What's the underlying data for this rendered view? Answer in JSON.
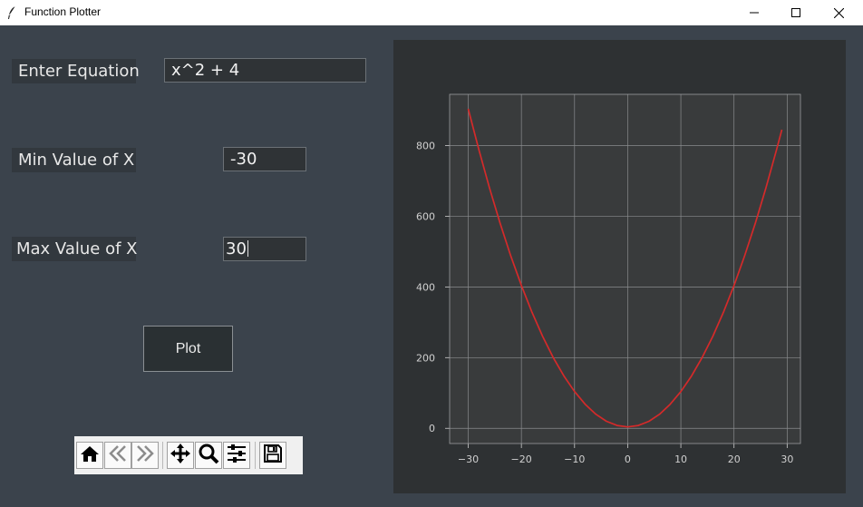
{
  "window": {
    "title": "Function Plotter",
    "app_icon": "feather-icon",
    "controls": [
      "minimize-icon",
      "maximize-icon",
      "close-icon"
    ]
  },
  "form": {
    "equation": {
      "label": "Enter Equation",
      "value": "x^2 + 4"
    },
    "min_x": {
      "label": "Min Value of X",
      "value": "-30"
    },
    "max_x": {
      "label": "Max Value of X",
      "value": "30"
    },
    "plot_button": "Plot"
  },
  "toolbar": {
    "buttons": [
      "home-icon",
      "back-icon",
      "forward-icon",
      "pan-icon",
      "zoom-icon",
      "configure-subplots-icon",
      "save-icon"
    ]
  },
  "chart_data": {
    "type": "line",
    "title": "",
    "xlabel": "",
    "ylabel": "",
    "xlim": [
      -33.5,
      32.5
    ],
    "ylim": [
      -43,
      945
    ],
    "xticks": [
      "−30",
      "−20",
      "−10",
      "0",
      "10",
      "20",
      "30"
    ],
    "yticks": [
      "0",
      "200",
      "400",
      "600",
      "800"
    ],
    "grid": true,
    "colors": {
      "line": "#d42a2a",
      "axes_bg": "#393b3c",
      "figure_bg": "#2e3133",
      "grid": "#8a8c8e"
    },
    "series": [
      {
        "x": [
          -30,
          -28,
          -26,
          -24,
          -22,
          -20,
          -18,
          -16,
          -14,
          -12,
          -10,
          -8,
          -6,
          -4,
          -2,
          0,
          2,
          4,
          6,
          8,
          10,
          12,
          14,
          16,
          18,
          20,
          22,
          24,
          26,
          28,
          29
        ],
        "y": [
          904,
          788,
          680,
          580,
          488,
          404,
          328,
          260,
          200,
          148,
          104,
          68,
          40,
          20,
          8,
          4,
          8,
          20,
          40,
          68,
          104,
          148,
          200,
          260,
          328,
          404,
          488,
          580,
          680,
          788,
          845
        ]
      }
    ]
  }
}
